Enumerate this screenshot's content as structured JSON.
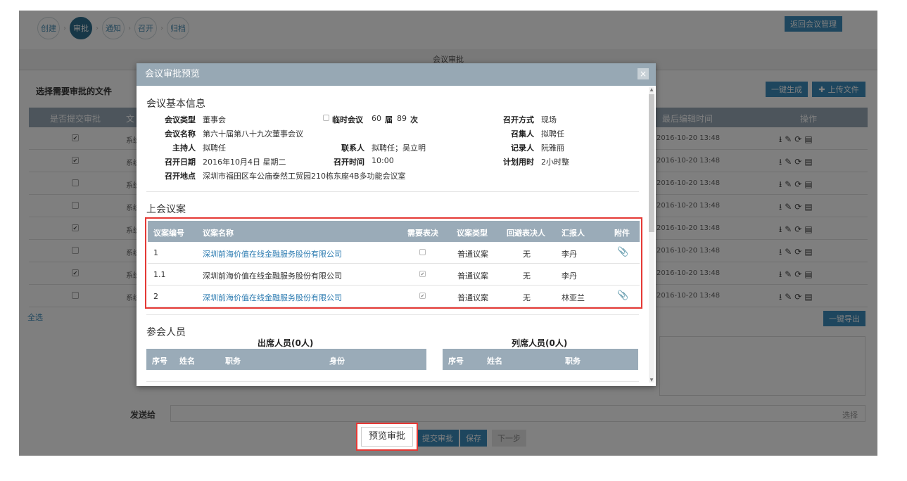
{
  "steps": [
    "创建",
    "审批",
    "通知",
    "召开",
    "归档"
  ],
  "active_step": "审批",
  "header": {
    "back_button": "返回会议管理"
  },
  "page": {
    "band_title": "会议审批",
    "section_title": "选择需要审批的文件",
    "gen_button": "一键生成",
    "upload_button": "上传文件",
    "upload_icon": "plus-icon",
    "table_headers": {
      "submit": "是否提交审批",
      "file": "文",
      "last_edit": "最后编辑时间",
      "actions": "操作"
    },
    "rows": [
      {
        "checked": true,
        "source": "系统",
        "time": "2016-10-20 13:48"
      },
      {
        "checked": true,
        "source": "系统",
        "time": "2016-10-20 13:48"
      },
      {
        "checked": false,
        "source": "系统",
        "time": "2016-10-20 13:48"
      },
      {
        "checked": false,
        "source": "系统",
        "time": "2016-10-20 13:48"
      },
      {
        "checked": true,
        "source": "系统",
        "time": "2016-10-20 13:48"
      },
      {
        "checked": false,
        "source": "系统",
        "time": "2016-10-20 13:48"
      },
      {
        "checked": true,
        "source": "系统",
        "time": "2016-10-20 13:48"
      },
      {
        "checked": false,
        "source": "系统",
        "time": "2016-10-20 13:48"
      }
    ],
    "select_all": "全选",
    "export_button": "一键导出",
    "send_to_label": "发送给",
    "send_to_select": "选择",
    "preview_button": "预览审批",
    "submit_button": "提交审批",
    "save_button": "保存",
    "next_button": "下一步"
  },
  "modal": {
    "title": "会议审批预览",
    "close": "×",
    "basic_title": "会议基本信息",
    "basic": {
      "type_label": "会议类型",
      "type_value": "董事会",
      "temp_label": "临时会议",
      "session_num": "60",
      "session_label": "届",
      "times_num": "89",
      "times_label": "次",
      "method_label": "召开方式",
      "method_value": "现场",
      "name_label": "会议名称",
      "name_value": "第六十届第八十九次董事会议",
      "convener_label": "召集人",
      "convener_value": "拟聘任",
      "host_label": "主持人",
      "host_value": "拟聘任",
      "contact_label": "联系人",
      "contact_value": "拟聘任；吴立明",
      "recorder_label": "记录人",
      "recorder_value": "阮雅丽",
      "date_label": "召开日期",
      "date_value": "2016年10月4日 星期二",
      "time_label": "召开时间",
      "time_value": "10:00",
      "duration_label": "计划用时",
      "duration_value": "2小时整",
      "place_label": "召开地点",
      "place_value": "深圳市福田区车公庙泰然工贸园210栋东座4B多功能会议室"
    },
    "agenda_title": "上会议案",
    "agenda_headers": {
      "no": "议案编号",
      "name": "议案名称",
      "vote": "需要表决",
      "type": "议案类型",
      "avoid": "回避表决人",
      "reporter": "汇报人",
      "attach": "附件"
    },
    "agenda_rows": [
      {
        "no": "1",
        "name": "深圳前海价值在线金融服务股份有限公司",
        "link": true,
        "vote": false,
        "type": "普通议案",
        "avoid": "无",
        "reporter": "李丹",
        "attach": true
      },
      {
        "no": "1.1",
        "name": "深圳前海价值在线金融服务股份有限公司",
        "link": false,
        "vote": true,
        "type": "普通议案",
        "avoid": "无",
        "reporter": "李丹",
        "attach": false
      },
      {
        "no": "2",
        "name": "深圳前海价值在线金融服务股份有限公司",
        "link": true,
        "vote": true,
        "type": "普通议案",
        "avoid": "无",
        "reporter": "林亚兰",
        "attach": true
      }
    ],
    "attendee_title": "参会人员",
    "attend_caption": "出席人员(0人)",
    "attend_headers": {
      "seq": "序号",
      "name": "姓名",
      "post": "职务",
      "identity": "身份"
    },
    "observer_caption": "列席人员(0人)",
    "observer_headers": {
      "seq": "序号",
      "name": "姓名",
      "post": "职务"
    }
  }
}
